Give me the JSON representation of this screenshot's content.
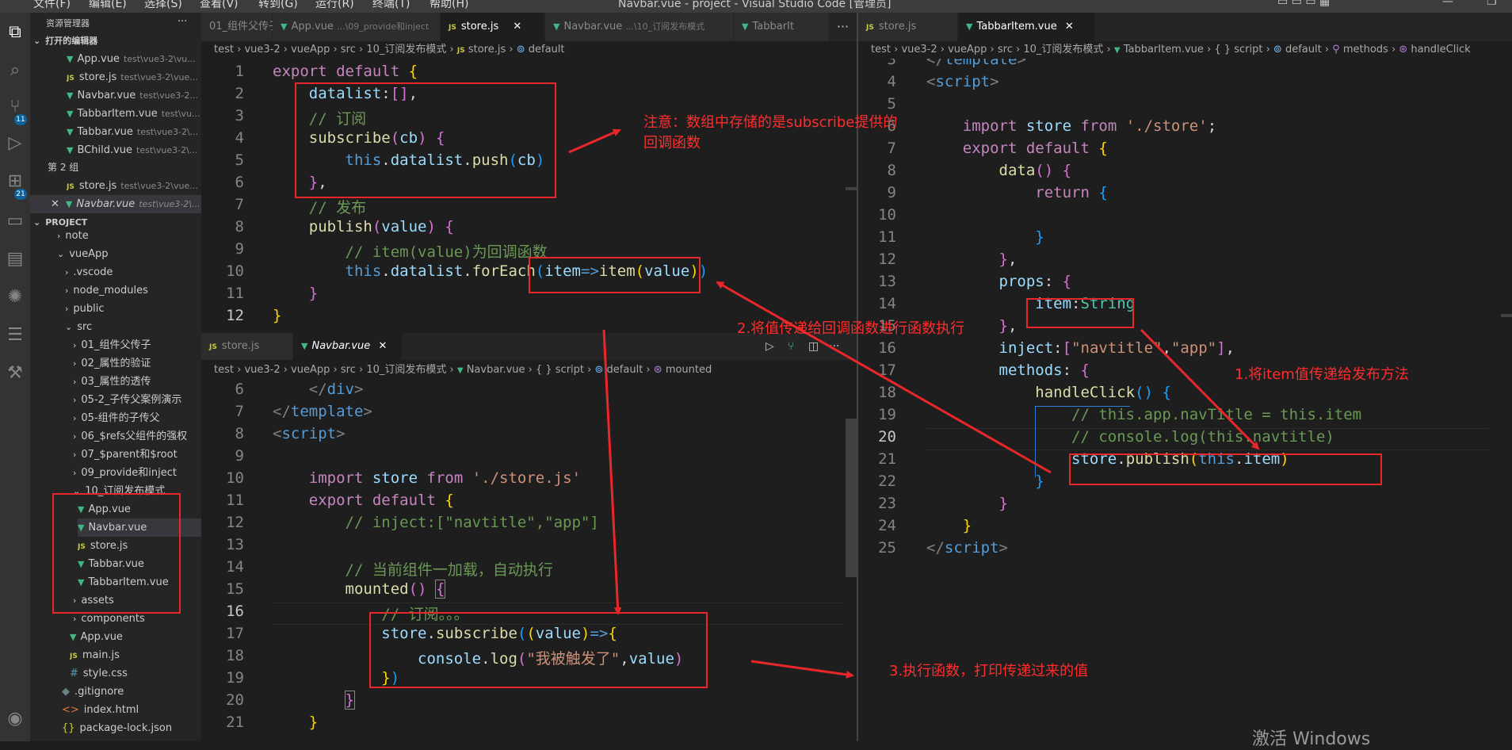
{
  "menubar": {
    "items": [
      "文件(F)",
      "编辑(E)",
      "选择(S)",
      "查看(V)",
      "转到(G)",
      "运行(R)",
      "终端(T)",
      "帮助(H)"
    ],
    "window_title": "Navbar.vue - project - Visual Studio Code [管理员]"
  },
  "activity": {
    "badges": {
      "source_control": "11",
      "extensions": "21"
    }
  },
  "sidebar": {
    "title": "资源管理器",
    "more": "···",
    "open_editors_label": "打开的编辑器",
    "group2_label": "第 2 组",
    "project_label": "PROJECT",
    "open_editors": [
      {
        "name": "App.vue",
        "path": "test\\vue3-2\\vu..."
      },
      {
        "name": "store.js",
        "path": "test\\vue3-2\\vue..."
      },
      {
        "name": "Navbar.vue",
        "path": "test\\vue3-2..."
      },
      {
        "name": "TabbarItem.vue",
        "path": "test\\vu..."
      },
      {
        "name": "Tabbar.vue",
        "path": "test\\vue3-2\\..."
      },
      {
        "name": "BChild.vue",
        "path": "test\\vue3-2\\..."
      }
    ],
    "group2": [
      {
        "name": "store.js",
        "path": "test\\vue3-2\\vue..."
      },
      {
        "name": "Navbar.vue",
        "path": "test\\vue3-2\\..."
      }
    ],
    "tree": [
      "note",
      "vueApp",
      ".vscode",
      "node_modules",
      "public",
      "src",
      "01_组件父传子",
      "02_属性的验证",
      "03_属性的透传",
      "05-2_子传父案例演示",
      "05-组件的子传父",
      "06_$refs父组件的强权",
      "07_$parent和$root",
      "09_provide和inject",
      "10_订阅发布模式",
      "App.vue",
      "Navbar.vue",
      "store.js",
      "Tabbar.vue",
      "TabbarItem.vue",
      "assets",
      "components",
      "App.vue",
      "main.js",
      "style.css",
      ".gitignore",
      "index.html",
      "package-lock.json"
    ]
  },
  "left_top": {
    "tabs": [
      "01_组件父传子",
      "App.vue",
      "...\\09_provide和inject",
      "store.js",
      "Navbar.vue",
      "...\\10_订阅发布模式",
      "TabbarIt"
    ],
    "breadcrumb": [
      "test",
      "vue3-2",
      "vueApp",
      "src",
      "10_订阅发布模式",
      "store.js",
      "default"
    ],
    "lines": [
      "1",
      "2",
      "3",
      "4",
      "5",
      "6",
      "7",
      "8",
      "9",
      "10",
      "11",
      "12"
    ]
  },
  "left_bottom": {
    "tabs": [
      "store.js",
      "Navbar.vue"
    ],
    "breadcrumb": [
      "test",
      "vue3-2",
      "vueApp",
      "src",
      "10_订阅发布模式",
      "Navbar.vue",
      "{ } script",
      "default",
      "mounted"
    ],
    "lines": [
      "6",
      "7",
      "8",
      "9",
      "10",
      "11",
      "12",
      "13",
      "14",
      "15",
      "16",
      "17",
      "18",
      "19",
      "20",
      "21"
    ]
  },
  "right": {
    "tabs": [
      "store.js",
      "TabbarItem.vue"
    ],
    "breadcrumb": [
      "test",
      "vue3-2",
      "vueApp",
      "src",
      "10_订阅发布模式",
      "TabbarItem.vue",
      "{ } script",
      "default",
      "methods",
      "handleClick"
    ],
    "lines": [
      "3",
      "4",
      "5",
      "6",
      "7",
      "8",
      "9",
      "10",
      "11",
      "12",
      "13",
      "14",
      "15",
      "16",
      "17",
      "18",
      "19",
      "20",
      "21",
      "22",
      "23",
      "24",
      "25"
    ]
  },
  "annotations": {
    "note": "注意：数组中存储的是subscribe提供的",
    "note2": "回调函数",
    "step1": "1.将item值传递给发布方法",
    "step2": "2.将值传递给回调函数进行函数执行",
    "step3": "3.执行函数，打印传递过来的值"
  },
  "watermark": "激活 Windows",
  "colors": {
    "annotation": "#e8272b",
    "vue_icon": "#41b883",
    "js_icon": "#cbcb41"
  }
}
